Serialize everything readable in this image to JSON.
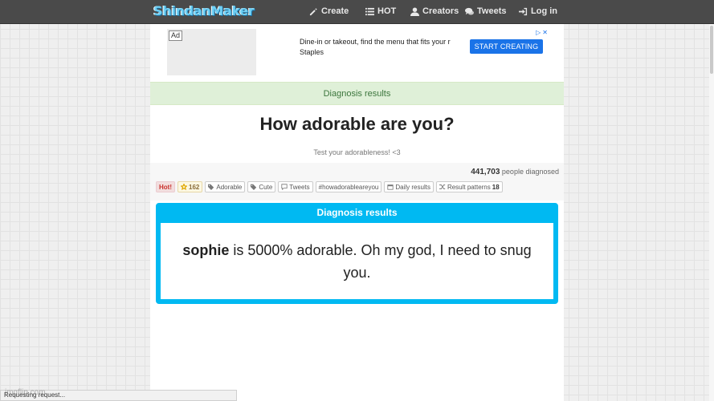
{
  "nav": {
    "brand": "ShindanMaker",
    "items": [
      {
        "label": "Create",
        "icon": "edit-icon"
      },
      {
        "label": "HOT",
        "icon": "list-icon"
      },
      {
        "label": "Creators",
        "icon": "user-icon"
      },
      {
        "label": "Tweets",
        "icon": "comments-icon"
      },
      {
        "label": "Log in",
        "icon": "login-icon"
      }
    ]
  },
  "ad": {
    "badge": "Ad",
    "line1": "Dine-in or takeout, find the menu that fits your r",
    "line2": "Staples",
    "cta": "START CREATING"
  },
  "diagnosis_bar": "Diagnosis results",
  "title": "How adorable are you?",
  "subtitle": "Test your adorableness! <3",
  "stats": {
    "count": "441,703",
    "count_label": "people diagnosed"
  },
  "tags": {
    "hot": "Hot!",
    "favorites": "162",
    "adorable": "Adorable",
    "cute": "Cute",
    "tweets": "Tweets",
    "hashtag": "#howadorableareyou",
    "daily": "Daily results",
    "patterns_label": "Result patterns",
    "patterns_count": "18"
  },
  "result": {
    "header": "Diagnosis results",
    "name": "sophie",
    "text": " is 5000% adorable. Oh my god, I need to snug you."
  },
  "status": "Requesting request...",
  "watermark": "imgflip.com",
  "colors": {
    "navbar": "#4a4a4a",
    "result_accent": "#00b9f2",
    "diagnosis_bar_bg": "#dff0d8"
  }
}
